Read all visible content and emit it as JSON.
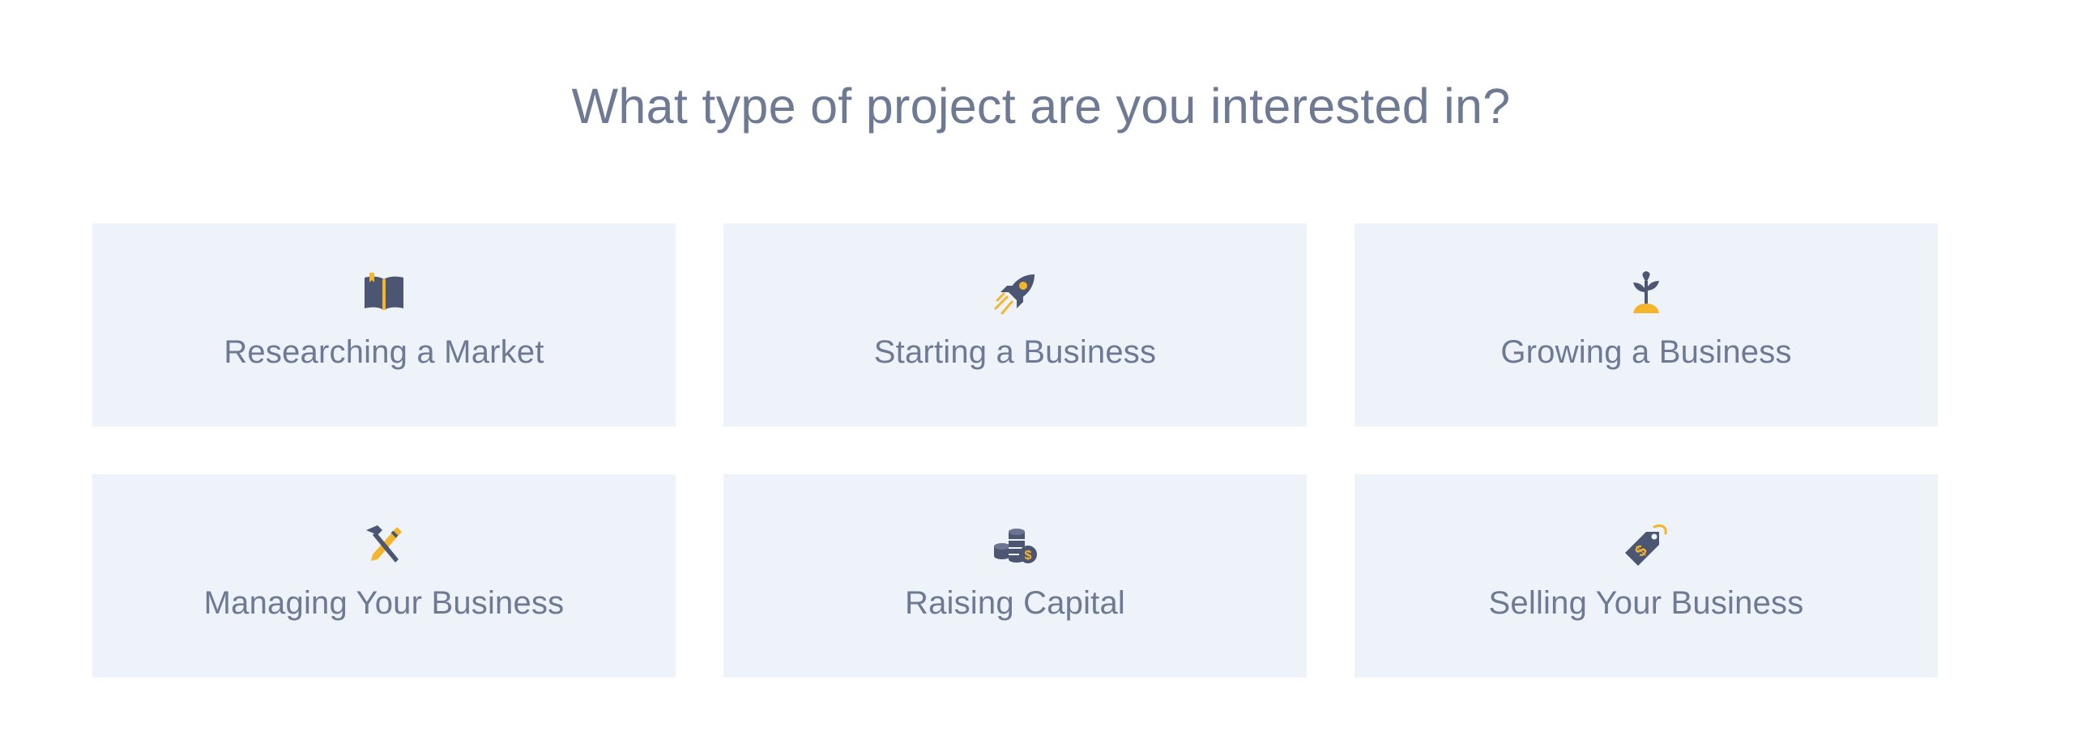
{
  "heading": "What type of project are you interested in?",
  "colors": {
    "accent": "#f5b52a",
    "icon_dark": "#4c5672",
    "card_bg": "#eef3fa",
    "text": "#6e7a94"
  },
  "options": [
    {
      "label": "Researching a Market",
      "icon": "book-icon"
    },
    {
      "label": "Starting a Business",
      "icon": "rocket-icon"
    },
    {
      "label": "Growing a Business",
      "icon": "sprout-icon"
    },
    {
      "label": "Managing Your Business",
      "icon": "tools-icon"
    },
    {
      "label": "Raising Capital",
      "icon": "coins-icon"
    },
    {
      "label": "Selling Your Business",
      "icon": "price-tag-icon"
    }
  ]
}
